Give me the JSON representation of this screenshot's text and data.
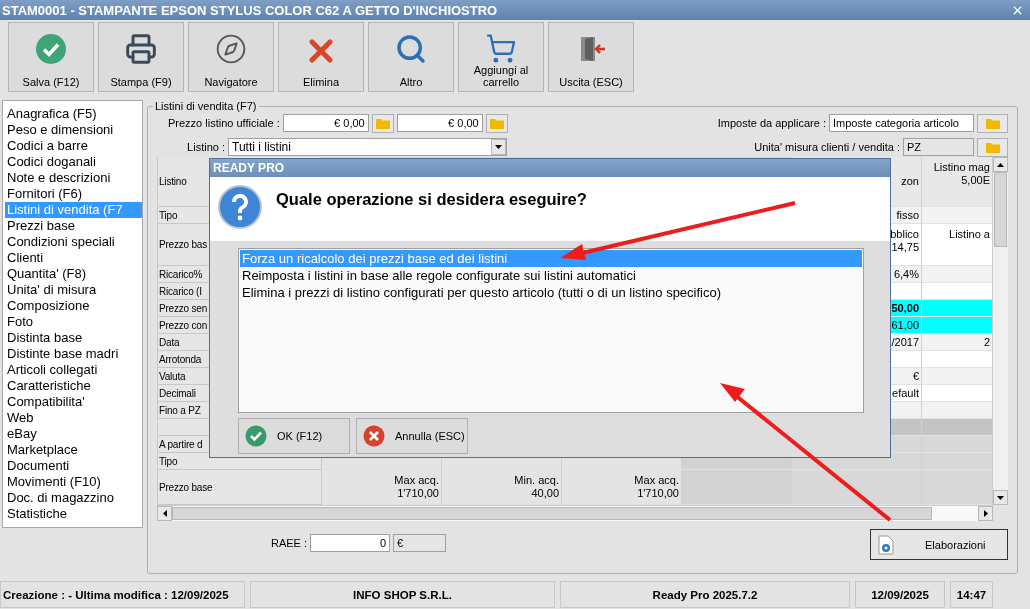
{
  "window": {
    "title": "STAM0001 - STAMPANTE EPSON STYLUS COLOR C62 A GETTO D'INCHIOSTRO"
  },
  "toolbar": [
    {
      "label": "Salva (F12)",
      "kind": "save"
    },
    {
      "label": "Stampa (F9)",
      "kind": "print"
    },
    {
      "label": "Navigatore",
      "kind": "navigator"
    },
    {
      "label": "Elimina",
      "kind": "delete"
    },
    {
      "label": "Altro",
      "kind": "other"
    },
    {
      "label": "Aggiungi al carrello",
      "kind": "cart"
    },
    {
      "label": "Uscita (ESC)",
      "kind": "exit"
    }
  ],
  "sidebar": {
    "items": [
      {
        "label": "Anagrafica (F5)",
        "selected": false
      },
      {
        "label": "Peso e dimensioni",
        "selected": false
      },
      {
        "label": "Codici a barre",
        "selected": false
      },
      {
        "label": "Codici doganali",
        "selected": false
      },
      {
        "label": "Note e descrizioni",
        "selected": false
      },
      {
        "label": "Fornitori (F6)",
        "selected": false
      },
      {
        "label": "Listini di vendita (F7",
        "selected": true
      },
      {
        "label": "Prezzi base",
        "selected": false
      },
      {
        "label": "Condizioni speciali",
        "selected": false
      },
      {
        "label": "Clienti",
        "selected": false
      },
      {
        "label": "Quantita' (F8)",
        "selected": false
      },
      {
        "label": "Unita' di misura",
        "selected": false
      },
      {
        "label": "Composizione",
        "selected": false
      },
      {
        "label": "Foto",
        "selected": false
      },
      {
        "label": "Distinta base",
        "selected": false
      },
      {
        "label": "Distinte base madri",
        "selected": false
      },
      {
        "label": "Articoli collegati",
        "selected": false
      },
      {
        "label": "Caratteristiche",
        "selected": false
      },
      {
        "label": "Compatibilita'",
        "selected": false
      },
      {
        "label": "Web",
        "selected": false
      },
      {
        "label": "eBay",
        "selected": false
      },
      {
        "label": "Marketplace",
        "selected": false
      },
      {
        "label": "Documenti",
        "selected": false
      },
      {
        "label": "Movimenti (F10)",
        "selected": false
      },
      {
        "label": "Doc. di magazzino",
        "selected": false
      },
      {
        "label": "Statistiche",
        "selected": false
      }
    ]
  },
  "section": {
    "title": "Listini di vendita (F7)",
    "official_price": {
      "label": "Prezzo listino ufficiale :",
      "values": [
        "€ 0,00",
        "€ 0,00"
      ]
    },
    "taxes": {
      "label": "Imposte da applicare :",
      "value": "Imposte categoria articolo"
    },
    "price_list": {
      "label": "Listino :",
      "value": "Tutti i listini"
    },
    "unit": {
      "label": "Unita' misura clienti / vendita :",
      "value": "PZ"
    },
    "table": {
      "rows": [
        {
          "kind": "header",
          "label": "Listino",
          "column_5": [
            "zon"
          ],
          "column_6": [
            "Listino mag",
            "5,00E"
          ],
          "highlighted": false,
          "bold": false
        },
        {
          "kind": "data",
          "label": "Tipo",
          "column_5": [
            "fisso"
          ],
          "highlighted": false,
          "bold": false
        },
        {
          "kind": "data",
          "label": "Prezzo bas",
          "column_5": [
            "bblico",
            "14,75"
          ],
          "column_6": [
            "Listino a"
          ],
          "highlighted": false,
          "bold": false
        },
        {
          "kind": "data",
          "label": "Ricarico%",
          "column_5": [
            "6,4%"
          ],
          "highlighted": false,
          "bold": false
        },
        {
          "kind": "data",
          "label": "Ricarico (I",
          "highlighted": false,
          "bold": false
        },
        {
          "kind": "data",
          "label": "Prezzo sen",
          "column_5": [
            "50,00"
          ],
          "highlighted": true,
          "bold": true
        },
        {
          "kind": "data",
          "label": "Prezzo con",
          "column_5": [
            "61,00"
          ],
          "highlighted": true,
          "bold": false
        },
        {
          "kind": "data",
          "label": "Data",
          "column_5": [
            "/2017"
          ],
          "column_6": [
            "2"
          ],
          "highlighted": false,
          "bold": false
        },
        {
          "kind": "data",
          "label": "Arrotonda",
          "highlighted": false,
          "bold": false
        },
        {
          "kind": "data",
          "label": "Valuta",
          "column_5": [
            "€"
          ],
          "highlighted": false,
          "bold": false
        },
        {
          "kind": "data",
          "label": "Decimali",
          "column_5": [
            "efault"
          ],
          "highlighted": false,
          "bold": false
        },
        {
          "kind": "data",
          "label": "Fino a PZ",
          "highlighted": false,
          "bold": false
        },
        {
          "kind": "separator",
          "highlighted": false,
          "bold": false
        },
        {
          "kind": "group",
          "label": "A partire d",
          "highlighted": false,
          "bold": false
        },
        {
          "kind": "group",
          "label": "Tipo",
          "highlighted": false,
          "bold": false
        },
        {
          "kind": "group",
          "label": "Prezzo base",
          "column_1": [
            "Max acq.",
            "1'710,00"
          ],
          "column_2": [
            "Min. acq.",
            "40,00"
          ],
          "column_3": [
            "Max acq.",
            "1'710,00"
          ],
          "highlighted": false,
          "bold": false
        }
      ]
    },
    "raee": {
      "label": "RAEE :",
      "value": "0",
      "unit": "€"
    },
    "action_button": "Elaborazioni"
  },
  "dialog": {
    "title": "READY PRO",
    "question": "Quale operazione si desidera eseguire?",
    "options": [
      {
        "label": "Forza un ricalcolo dei prezzi base ed dei listini",
        "selected": true
      },
      {
        "label": "Reimposta i listini in base alle regole configurate sui listini automatici",
        "selected": false
      },
      {
        "label": "Elimina i prezzi di listino configurati per questo articolo (tutti o di un listino specifico)",
        "selected": false
      }
    ],
    "buttons": [
      {
        "label": "OK (F12)",
        "kind": "ok"
      },
      {
        "label": "Annulla (ESC)",
        "kind": "cancel"
      }
    ]
  },
  "status_bar": [
    "Creazione :  - Ultima modifica : 12/09/2025",
    "INFO SHOP S.R.L.",
    "Ready Pro 2025.7.2",
    "12/09/2025",
    "14:47"
  ]
}
